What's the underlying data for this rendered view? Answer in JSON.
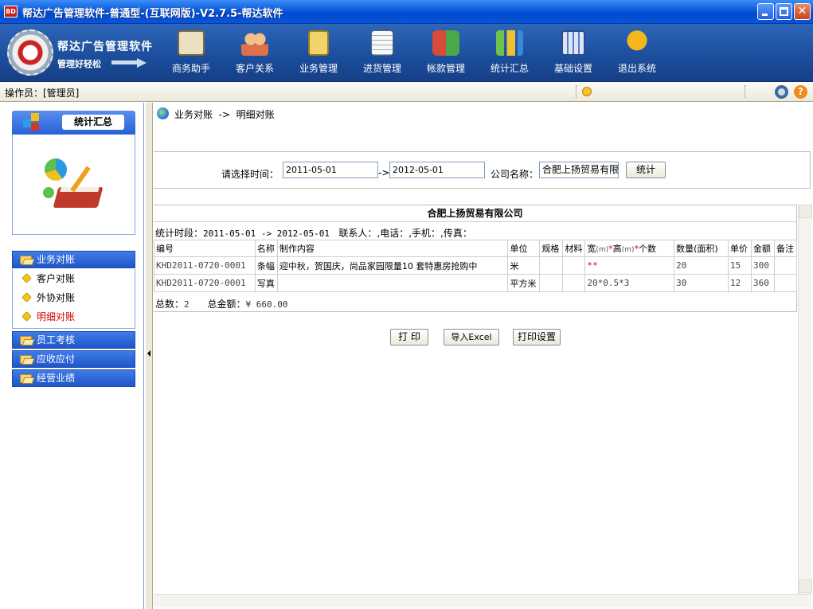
{
  "window": {
    "logo_text": "BD",
    "title": "帮达广告管理软件-普通型-(互联网版)-V2.7.5-帮达软件"
  },
  "brand": {
    "title": "帮达广告管理软件",
    "slogan": "管理好轻松"
  },
  "toolbar": [
    {
      "label": "商务助手",
      "icon": "pencil-notebook-icon",
      "color": "#e8e0c0"
    },
    {
      "label": "客户关系",
      "icon": "people-icon",
      "color": "#e0704a"
    },
    {
      "label": "业务管理",
      "icon": "clipboard-icon",
      "color": "#f2d26a"
    },
    {
      "label": "进货管理",
      "icon": "document-edit-icon",
      "color": "#f0f0f0"
    },
    {
      "label": "帐款管理",
      "icon": "transfer-arrows-icon",
      "color": "#d84a3a"
    },
    {
      "label": "统计汇总",
      "icon": "chart-icon",
      "color": "#6fc24a"
    },
    {
      "label": "基础设置",
      "icon": "calculator-icon",
      "color": "#5a7cc8"
    },
    {
      "label": "退出系统",
      "icon": "exit-icon",
      "color": "#f5b81c"
    }
  ],
  "operator": {
    "text": "操作员：[管理员]"
  },
  "leftpanel": {
    "section_title": "统计汇总",
    "groups": [
      {
        "label": "业务对账"
      },
      {
        "label": "员工考核"
      },
      {
        "label": "应收应付"
      },
      {
        "label": "经营业绩"
      }
    ],
    "subitems": [
      {
        "label": "客户对账"
      },
      {
        "label": "外协对账"
      },
      {
        "label": "明细对账"
      }
    ]
  },
  "main": {
    "breadcrumb": "业务对账  ->  明细对账",
    "filter": {
      "time_label": "请选择时间：",
      "date_from": "2011-05-01",
      "arrow": "->",
      "date_to": "2012-05-01",
      "company_label": "公司名称：",
      "company_value": "合肥上扬贸易有限",
      "stat_button": "统计"
    },
    "report": {
      "title": "合肥上扬贸易有限公司",
      "period_prefix": "统计时段：",
      "period": "2011-05-01 -> 2012-05-01",
      "contacts": "联系人：,电话：,手机：,传真：",
      "headers": {
        "code": "编号",
        "name": "名称",
        "content": "制作内容",
        "unit": "单位",
        "spec": "规格",
        "material": "材料",
        "width": "宽",
        "unit_m1": "(m)",
        "star1": "*",
        "height": "高",
        "unit_m2": "(m)",
        "star2": "*",
        "count": "个数",
        "qty": "数量(面积)",
        "price": "单价",
        "amount": "金额",
        "remark": "备注"
      },
      "rows": [
        {
          "code": "KHD2011-0720-0001",
          "name": "条幅",
          "content": "迎中秋，贺国庆，尚品家园限量10 套特惠房抢购中",
          "unit": "米",
          "spec": "",
          "material": "",
          "size": "**",
          "qty": "20",
          "price": "15",
          "amount": "300",
          "remark": ""
        },
        {
          "code": "KHD2011-0720-0001",
          "name": "写真",
          "content": "",
          "unit": "平方米",
          "spec": "",
          "material": "",
          "size": "20*0.5*3",
          "qty": "30",
          "price": "12",
          "amount": "360",
          "remark": ""
        }
      ],
      "total_count_label": "总数：",
      "total_count": "2",
      "total_amount_label": "总金额：",
      "total_amount": "¥ 660.00"
    },
    "buttons": {
      "print": "打 印",
      "export": "导入Excel",
      "print_setup": "打印设置"
    }
  }
}
